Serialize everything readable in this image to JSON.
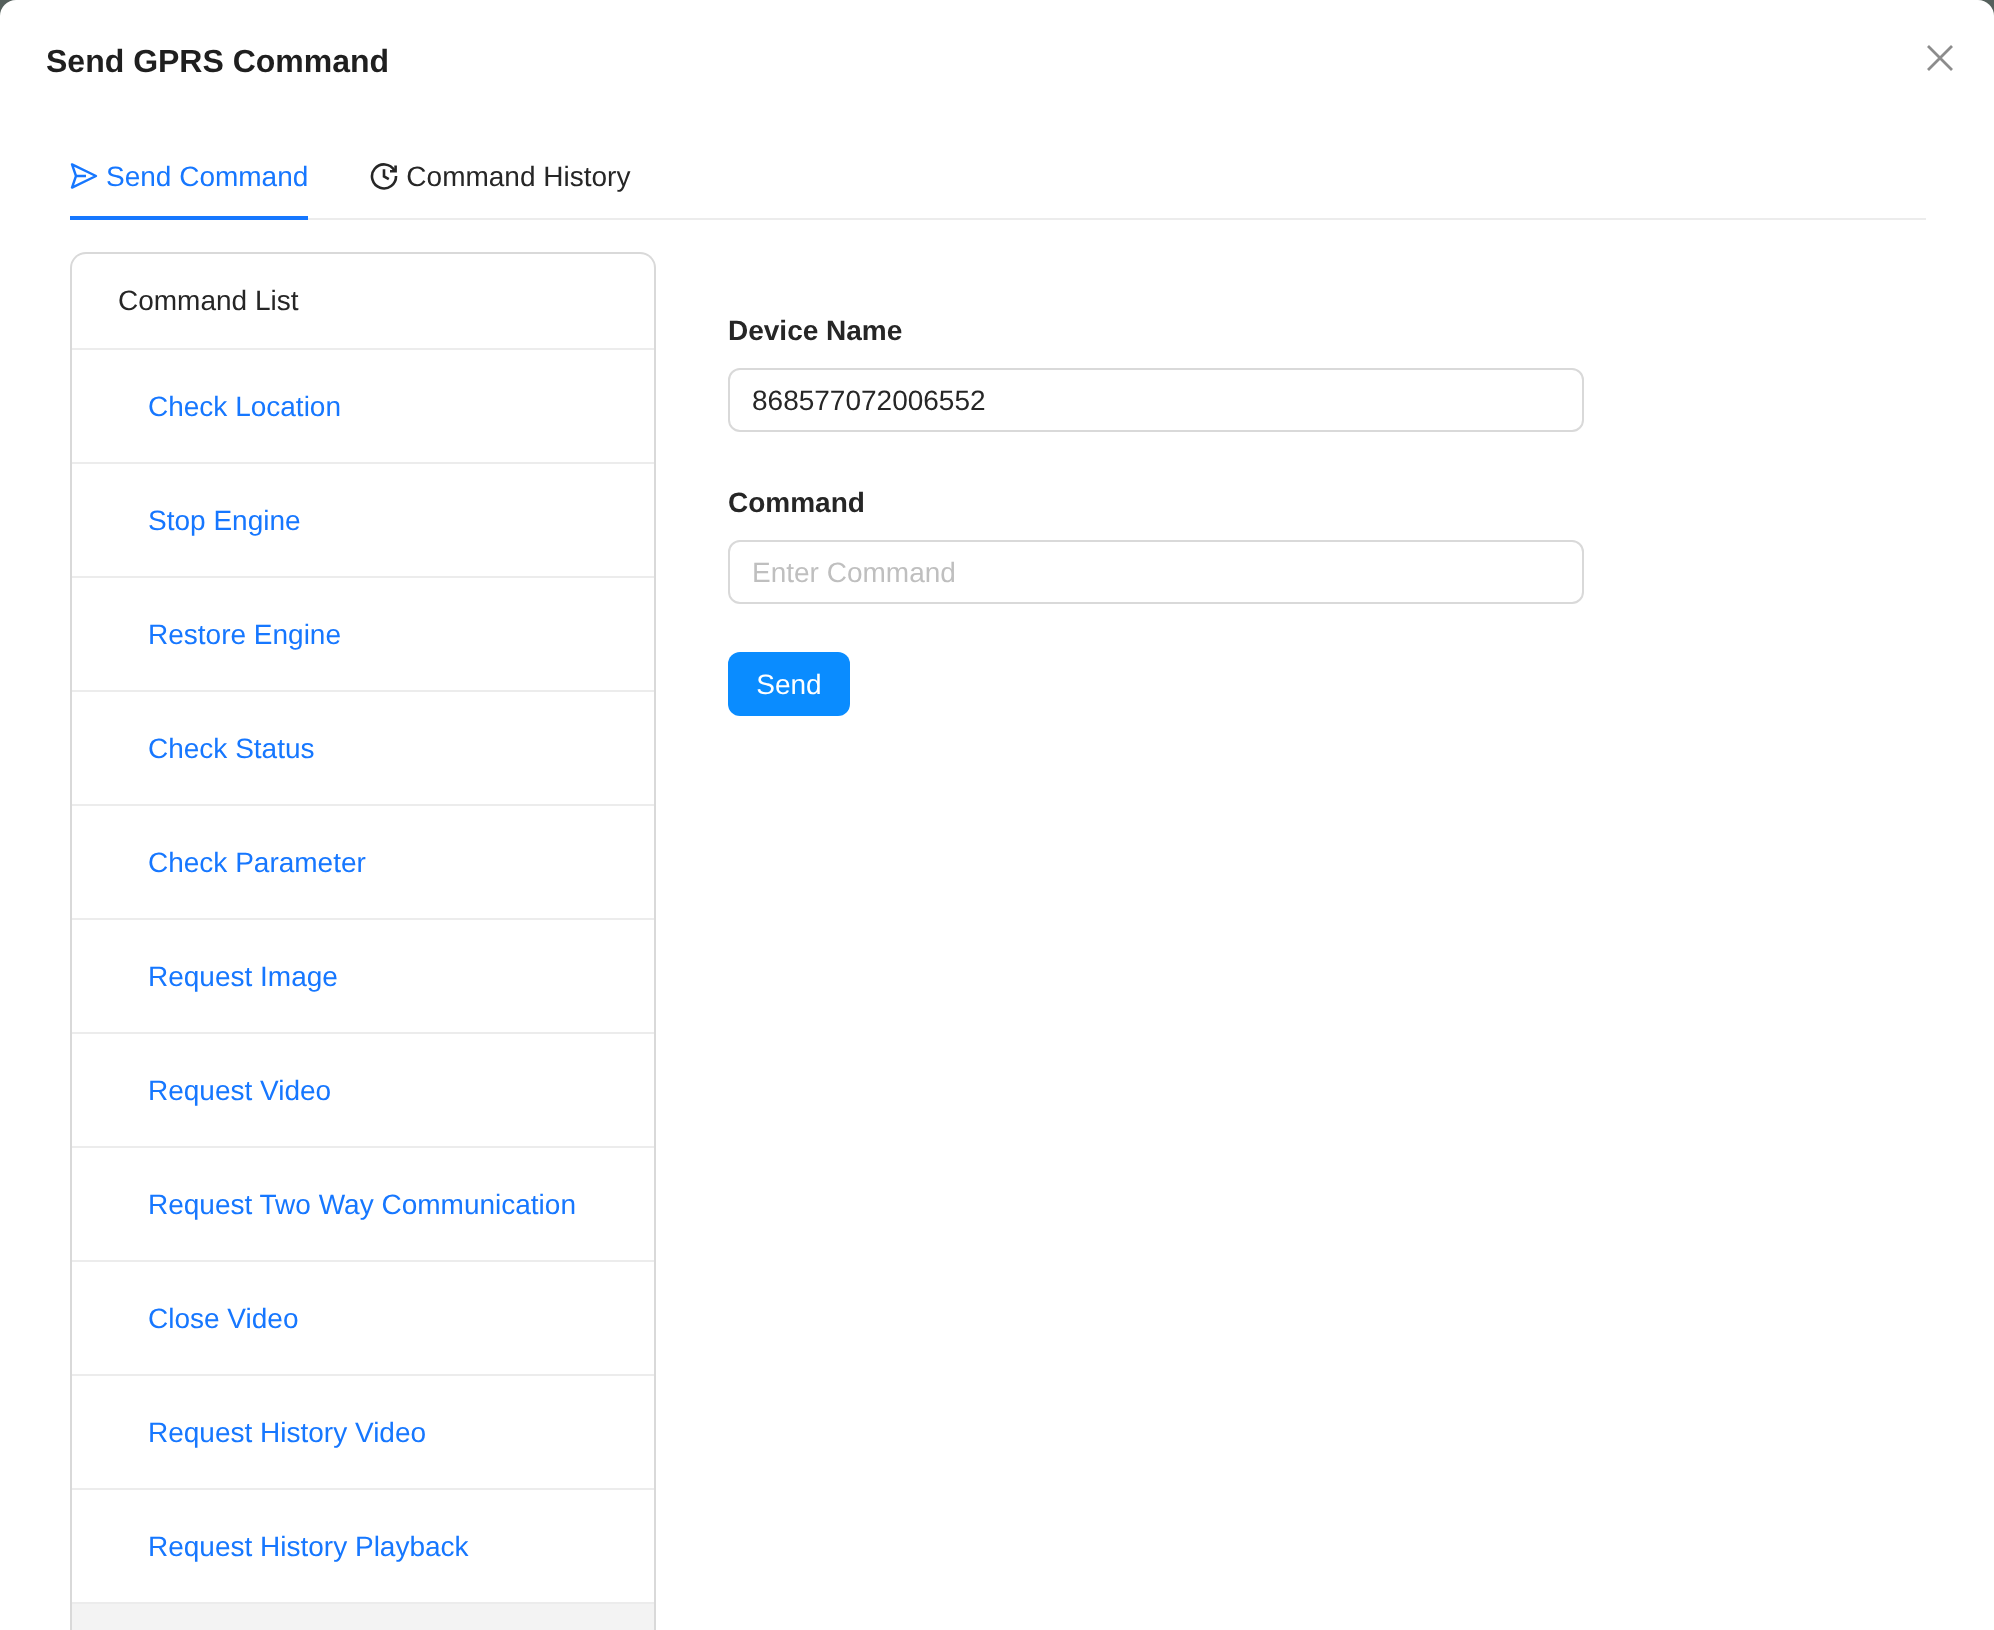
{
  "dialog": {
    "title": "Send GPRS Command"
  },
  "tabs": [
    {
      "kind": "send",
      "label": "Send Command",
      "selected": true
    },
    {
      "kind": "history",
      "label": "Command History",
      "selected": false
    }
  ],
  "command_list": {
    "title": "Command List",
    "items": [
      {
        "label": "Check Location"
      },
      {
        "label": "Stop Engine"
      },
      {
        "label": "Restore Engine"
      },
      {
        "label": "Check Status"
      },
      {
        "label": "Check Parameter"
      },
      {
        "label": "Request Image"
      },
      {
        "label": "Request Video"
      },
      {
        "label": "Request Two Way Communication"
      },
      {
        "label": "Close Video"
      },
      {
        "label": "Request History Video"
      },
      {
        "label": "Request History Playback"
      }
    ]
  },
  "form": {
    "fields": [
      {
        "label": "Device Name",
        "value": "868577072006552"
      },
      {
        "label": "Command",
        "placeholder": "Enter Command"
      }
    ],
    "submit": "Send"
  }
}
